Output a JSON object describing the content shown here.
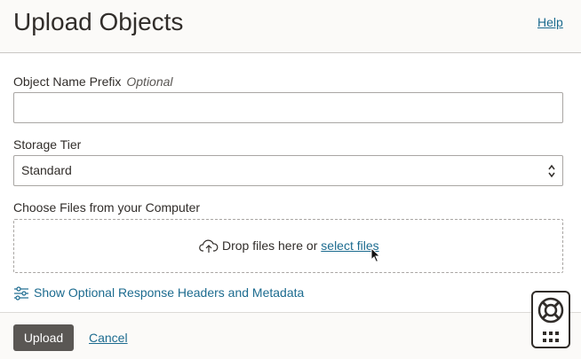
{
  "header": {
    "title": "Upload Objects",
    "help_label": "Help"
  },
  "form": {
    "prefix": {
      "label": "Object Name Prefix",
      "optional_label": "Optional",
      "value": ""
    },
    "storage_tier": {
      "label": "Storage Tier",
      "value": "Standard"
    },
    "files": {
      "label": "Choose Files from your Computer",
      "drop_text": "Drop files here or ",
      "select_link": "select files",
      "icon": "cloud-upload-icon"
    },
    "optional_headers_link": "Show Optional Response Headers and Metadata"
  },
  "footer": {
    "upload_label": "Upload",
    "cancel_label": "Cancel"
  },
  "colors": {
    "link": "#1c6b8f",
    "primary_button": "#5a5754",
    "text": "#312d2a"
  }
}
